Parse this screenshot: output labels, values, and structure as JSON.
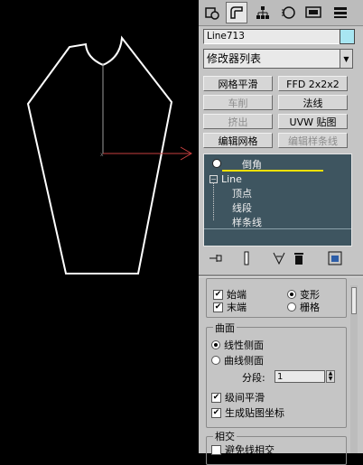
{
  "panel": {
    "object_name": "Line713",
    "object_color": "#a8e6f2",
    "modifier_list": "修改器列表",
    "buttons": [
      {
        "label": "网格平滑",
        "enabled": true
      },
      {
        "label": "FFD 2x2x2",
        "enabled": true
      },
      {
        "label": "车削",
        "enabled": false
      },
      {
        "label": "法线",
        "enabled": true
      },
      {
        "label": "挤出",
        "enabled": false
      },
      {
        "label": "UVW 贴图",
        "enabled": true
      },
      {
        "label": "编辑网格",
        "enabled": true
      },
      {
        "label": "编辑样条线",
        "enabled": false
      }
    ],
    "stack": {
      "modifier": "倒角",
      "base": "Line",
      "subitems": [
        "顶点",
        "线段",
        "样条线"
      ]
    },
    "caps": {
      "start": "始端",
      "end": "末端",
      "morph": "变形",
      "grid": "栅格"
    },
    "surface": {
      "title": "曲面",
      "linear_sides": "线性侧面",
      "curved_sides": "曲线侧面",
      "segments_label": "分段:",
      "segments_value": "1",
      "smooth_across_levels": "级间平滑",
      "gen_mapping_coords": "生成贴图坐标"
    },
    "intersections": {
      "title": "相交",
      "keep_lines_from_crossing": "避免线相交"
    }
  },
  "icons": {
    "tabs": [
      "create-icon",
      "modify-icon",
      "hierarchy-icon",
      "motion-icon",
      "display-icon",
      "utilities-icon"
    ],
    "stack_tools": [
      "pin-stack-icon",
      "show-end-result-icon",
      "make-unique-icon",
      "remove-modifier-icon",
      "configure-sets-icon"
    ]
  }
}
